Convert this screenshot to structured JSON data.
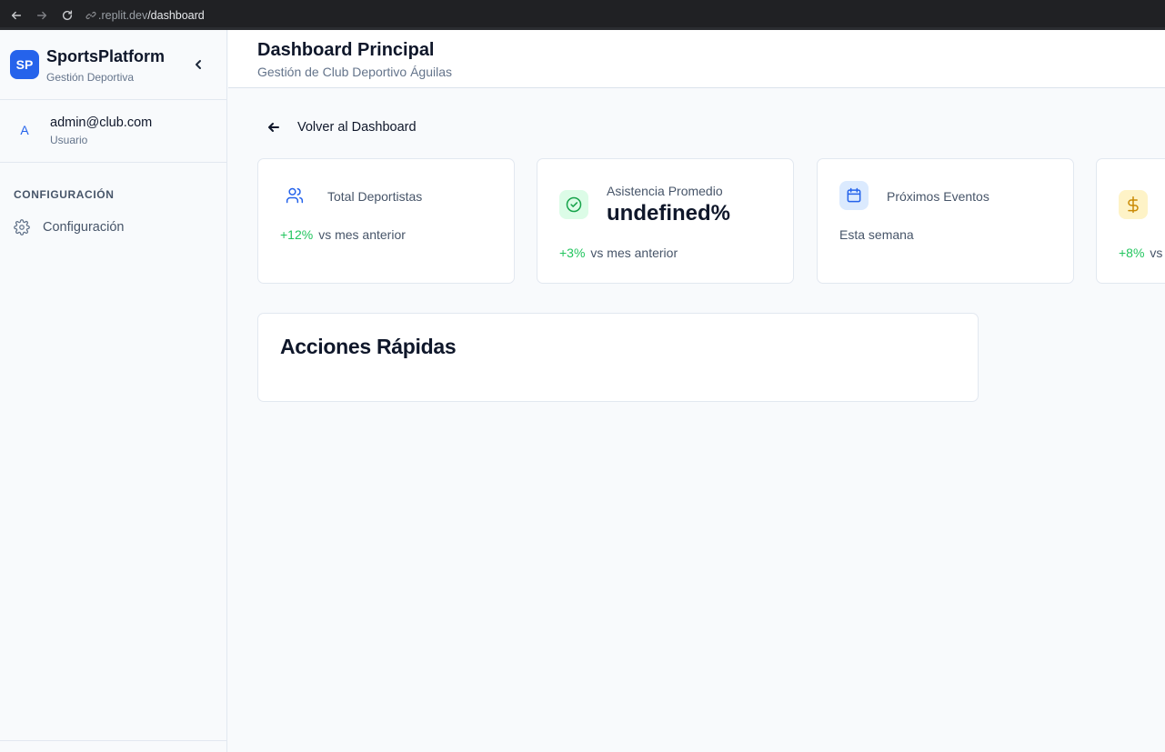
{
  "browser": {
    "url_host": ".replit.dev",
    "url_path": "/dashboard"
  },
  "sidebar": {
    "logo_text": "SP",
    "brand_name": "SportsPlatform",
    "brand_subtitle": "Gestión Deportiva",
    "user": {
      "avatar_initial": "A",
      "email": "admin@club.com",
      "role": "Usuario"
    },
    "section_title": "CONFIGURACIÓN",
    "items": [
      {
        "label": "Configuración",
        "icon": "gear-icon"
      }
    ]
  },
  "header": {
    "title": "Dashboard Principal",
    "subtitle": "Gestión de Club Deportivo Águilas"
  },
  "main": {
    "back_label": "Volver al Dashboard",
    "stats": [
      {
        "label": "Total Deportistas",
        "value": "",
        "trend": "+12%",
        "foot": "vs mes anterior",
        "icon": "users-icon",
        "icon_color": "#2563eb",
        "icon_bg": "#ffffff"
      },
      {
        "label": "Asistencia Promedio",
        "value": "undefined%",
        "trend": "+3%",
        "foot": "vs mes anterior",
        "icon": "check-circle-icon",
        "icon_color": "#16a34a",
        "icon_bg": "#dcfce7"
      },
      {
        "label": "Próximos Eventos",
        "value": "",
        "trend": "",
        "foot": "Esta semana",
        "icon": "calendar-icon",
        "icon_color": "#2563eb",
        "icon_bg": "#dbeafe"
      },
      {
        "label": "",
        "value": "",
        "trend": "+8%",
        "foot": "vs",
        "icon": "dollar-icon",
        "icon_color": "#ca8a04",
        "icon_bg": "#fef3c7"
      }
    ],
    "quick_actions": {
      "title": "Acciones Rápidas"
    }
  },
  "colors": {
    "accent": "#2563eb",
    "positive": "#22c55e",
    "text_primary": "#0f172a",
    "text_muted": "#64748b"
  }
}
